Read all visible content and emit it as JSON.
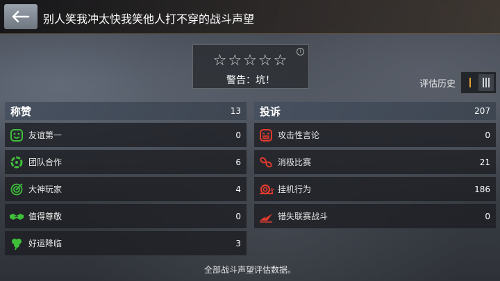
{
  "header": {
    "title": "别人笑我冲太快我笑他人打不穿的战斗声望"
  },
  "rating": {
    "stars_total": 5,
    "stars_filled": 0,
    "warning": "警告：坑！"
  },
  "history": {
    "label": "评估历史"
  },
  "praise": {
    "title": "称赞",
    "count": "13",
    "items": [
      {
        "label": "友谊第一",
        "value": "0",
        "icon": "smile-icon"
      },
      {
        "label": "团队合作",
        "value": "6",
        "icon": "teamwork-ring-icon"
      },
      {
        "label": "大神玩家",
        "value": "4",
        "icon": "target-icon"
      },
      {
        "label": "值得尊敬",
        "value": "0",
        "icon": "handshake-icon"
      },
      {
        "label": "好运降临",
        "value": "3",
        "icon": "clover-icon"
      }
    ]
  },
  "complaint": {
    "title": "投诉",
    "count": "207",
    "items": [
      {
        "label": "攻击性言论",
        "value": "0",
        "icon": "angry-face-icon"
      },
      {
        "label": "消极比赛",
        "value": "21",
        "icon": "chain-icon"
      },
      {
        "label": "挂机行为",
        "value": "186",
        "icon": "snail-icon"
      },
      {
        "label": "错失联赛战斗",
        "value": "0",
        "icon": "broken-arrow-icon"
      }
    ]
  },
  "footer": {
    "text": "全部战斗声望评估数据。"
  },
  "colors": {
    "praise_icon": "#3fbf3a",
    "complaint_icon": "#e23a2e",
    "toggle_active": "#e8a030"
  }
}
